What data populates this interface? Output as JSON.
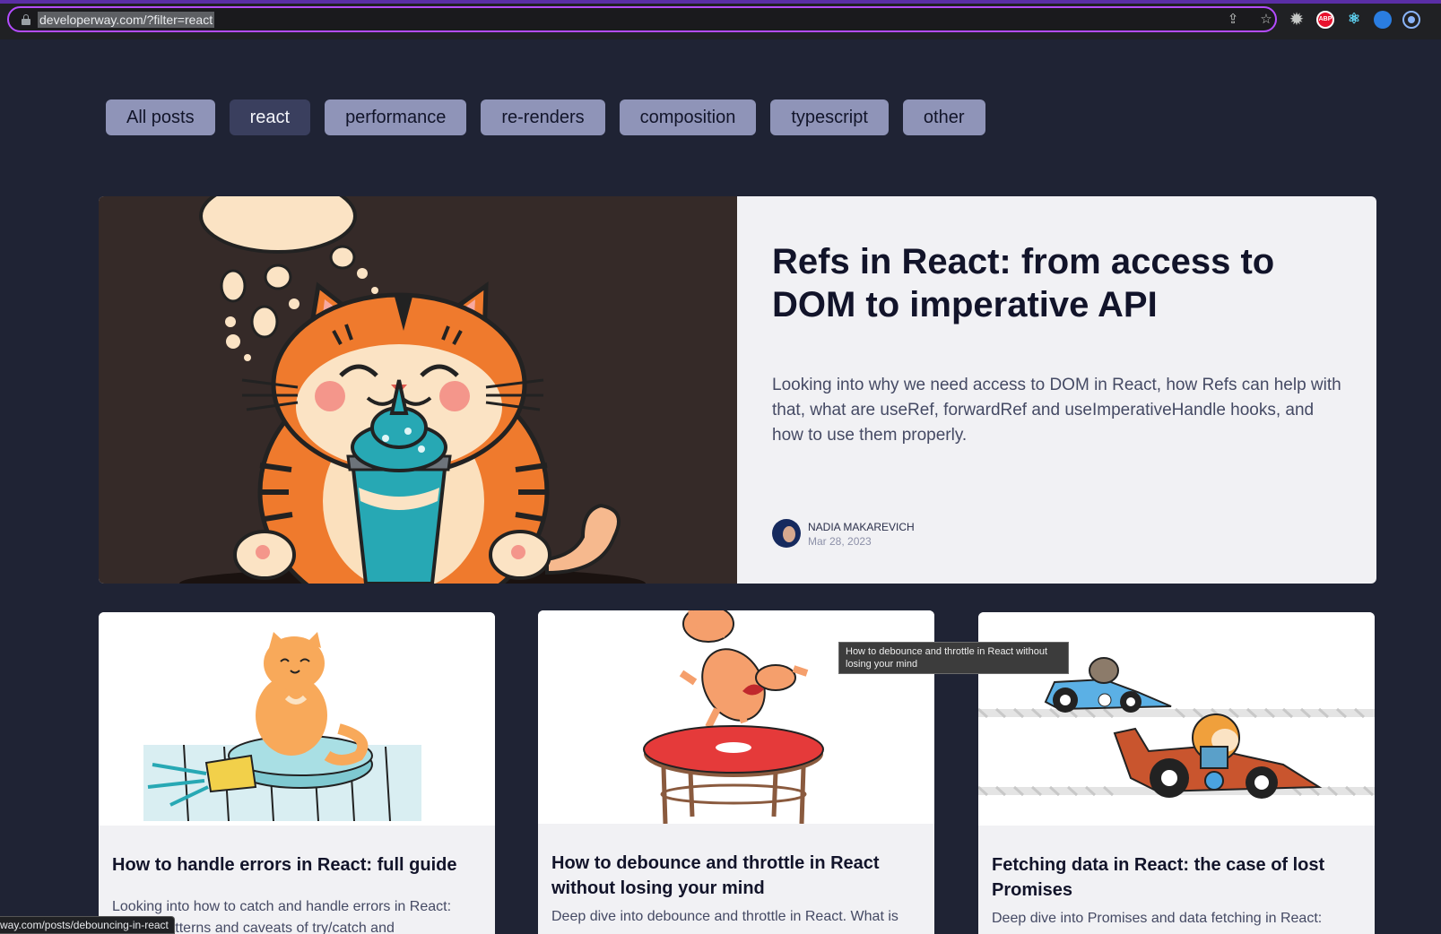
{
  "browser": {
    "url": "developerway.com/?filter=react",
    "status_url": "way.com/posts/debouncing-in-react",
    "extensions": [
      "gear-icon",
      "adblock-icon",
      "react-devtools-icon",
      "blue-extension-icon",
      "target-icon"
    ],
    "abp_label": "ABP"
  },
  "filters": {
    "items": [
      {
        "label": "All posts",
        "active": false
      },
      {
        "label": "react",
        "active": true
      },
      {
        "label": "performance",
        "active": false
      },
      {
        "label": "re-renders",
        "active": false
      },
      {
        "label": "composition",
        "active": false
      },
      {
        "label": "typescript",
        "active": false
      },
      {
        "label": "other",
        "active": false
      }
    ]
  },
  "hero": {
    "title": "Refs in React: from access to DOM to imperative API",
    "description": "Looking into why we need access to DOM in React, how Refs can help with that, what are useRef, forwardRef and useImperativeHandle hooks, and how to use them properly.",
    "author": "NADIA MAKAREVICH",
    "date": "Mar 28, 2023",
    "image": "cat-with-milkshake-illustration"
  },
  "cards": [
    {
      "title": "How to handle errors in React: full guide",
      "description": "Looking into how to catch and handle errors in React: usage, patterns and caveats of try/catch and",
      "image": "cat-on-robot-vacuum-illustration"
    },
    {
      "title": "How to debounce and throttle in React without losing your mind",
      "description": "Deep dive into debounce and throttle in React. What is",
      "image": "cat-bouncing-on-trampoline-illustration"
    },
    {
      "title": "Fetching data in React: the case of lost Promises",
      "description": "Deep dive into Promises and data fetching in React:",
      "image": "animals-racing-cars-illustration"
    }
  ],
  "tooltip": {
    "text": "How to debounce and throttle in React without losing your mind"
  },
  "colors": {
    "page_bg": "#1f2334",
    "pill_bg": "#8f94b8",
    "pill_active_bg": "#3a3f5e",
    "card_bg": "#f1f1f4",
    "url_border": "#b44cff"
  }
}
